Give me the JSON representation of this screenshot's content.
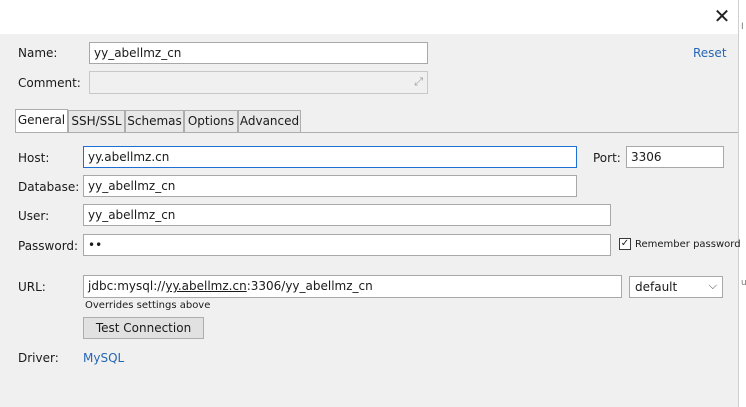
{
  "window": {
    "close_glyph": "✕"
  },
  "header": {
    "name_label": "Name:",
    "name_value": "yy_abellmz_cn",
    "reset_label": "Reset",
    "comment_label": "Comment:"
  },
  "tabs": [
    {
      "label": "General",
      "active": true
    },
    {
      "label": "SSH/SSL",
      "active": false
    },
    {
      "label": "Schemas",
      "active": false
    },
    {
      "label": "Options",
      "active": false
    },
    {
      "label": "Advanced",
      "active": false
    }
  ],
  "general": {
    "host_label": "Host:",
    "host_value": "yy.abellmz.cn",
    "port_label": "Port:",
    "port_value": "3306",
    "database_label": "Database:",
    "database_value": "yy_abellmz_cn",
    "user_label": "User:",
    "user_value": "yy_abellmz_cn",
    "password_label": "Password:",
    "password_value": "••",
    "remember_label": "Remember password",
    "remember_checked": true,
    "url_label": "URL:",
    "url_prefix": "jdbc:mysql://",
    "url_host": "yy.abellmz.cn",
    "url_suffix": ":3306/yy_abellmz_cn",
    "url_hint": "Overrides settings above",
    "url_mode": "default",
    "test_button": "Test Connection",
    "driver_label": "Driver:",
    "driver_value": "MySQL"
  },
  "edge_fragments": {
    "top": "I",
    "middle": "u"
  }
}
